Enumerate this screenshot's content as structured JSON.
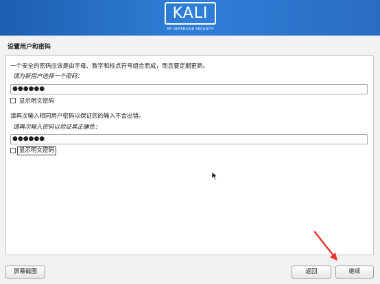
{
  "header": {
    "logo_text": "KALI",
    "logo_subtitle": "BY OFFENSIVE SECURITY"
  },
  "page": {
    "title": "设置用户和密码"
  },
  "form": {
    "intro": "一个安全的密码应该是由字母、数字和标点符号组合而成，而且要定期更新。",
    "password_prompt": "请为新用户选择一个密码：",
    "password_value": "●●●●●●",
    "show_password_label": "显示明文密码",
    "confirm_intro": "请再次输入相同用户密码以保证您的输入不会出错。",
    "confirm_prompt": "请再次输入密码以验证其正确性：",
    "confirm_value": "●●●●●●",
    "show_confirm_label": "显示明文密码"
  },
  "footer": {
    "screenshot_button": "屏幕截图",
    "back_button": "返回",
    "continue_button": "继续"
  },
  "colors": {
    "banner": "#2f7fd8",
    "annotation_arrow": "#e8352e"
  }
}
